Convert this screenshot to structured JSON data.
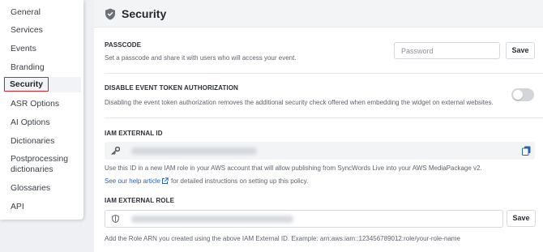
{
  "sidebar": {
    "items": [
      {
        "label": "General"
      },
      {
        "label": "Services"
      },
      {
        "label": "Events"
      },
      {
        "label": "Branding"
      },
      {
        "label": "Security",
        "active": true
      },
      {
        "label": "ASR Options"
      },
      {
        "label": "AI Options"
      },
      {
        "label": "Dictionaries"
      },
      {
        "label": "Postprocessing"
      },
      {
        "label": "dictionaries"
      },
      {
        "label": "Glossaries"
      },
      {
        "label": "API"
      }
    ]
  },
  "header": {
    "title": "Security",
    "icon": "shield-icon"
  },
  "passcode": {
    "label": "PASSCODE",
    "description": "Set a passcode and share it with users who will access your event.",
    "placeholder": "Password",
    "save_label": "Save"
  },
  "token_auth": {
    "label": "DISABLE EVENT TOKEN AUTHORIZATION",
    "description": "Disabling the event token authorization removes the additional security check offered when embedding the widget on external websites.",
    "enabled": false
  },
  "iam_external_id": {
    "label": "IAM EXTERNAL ID",
    "icon": "key-icon",
    "copy_icon": "copy-icon",
    "description": "Use this ID in a new IAM role in your AWS account that will allow publishing from SyncWords Live into your AWS MediaPackage v2.",
    "help_link": "See our help article",
    "help_rest": "for detailed instructions on setting up this policy."
  },
  "iam_external_role": {
    "label": "IAM EXTERNAL ROLE",
    "icon": "shield-icon",
    "save_label": "Save",
    "description": "Add the Role ARN you created using the above IAM External ID. Example: arn:aws:iam::123456789012:role/your-role-name"
  },
  "colors": {
    "active_highlight": "#c7262b",
    "link": "#2a63b6",
    "header_bg": "#f3f4f6",
    "page_bg": "#eef0f3"
  }
}
